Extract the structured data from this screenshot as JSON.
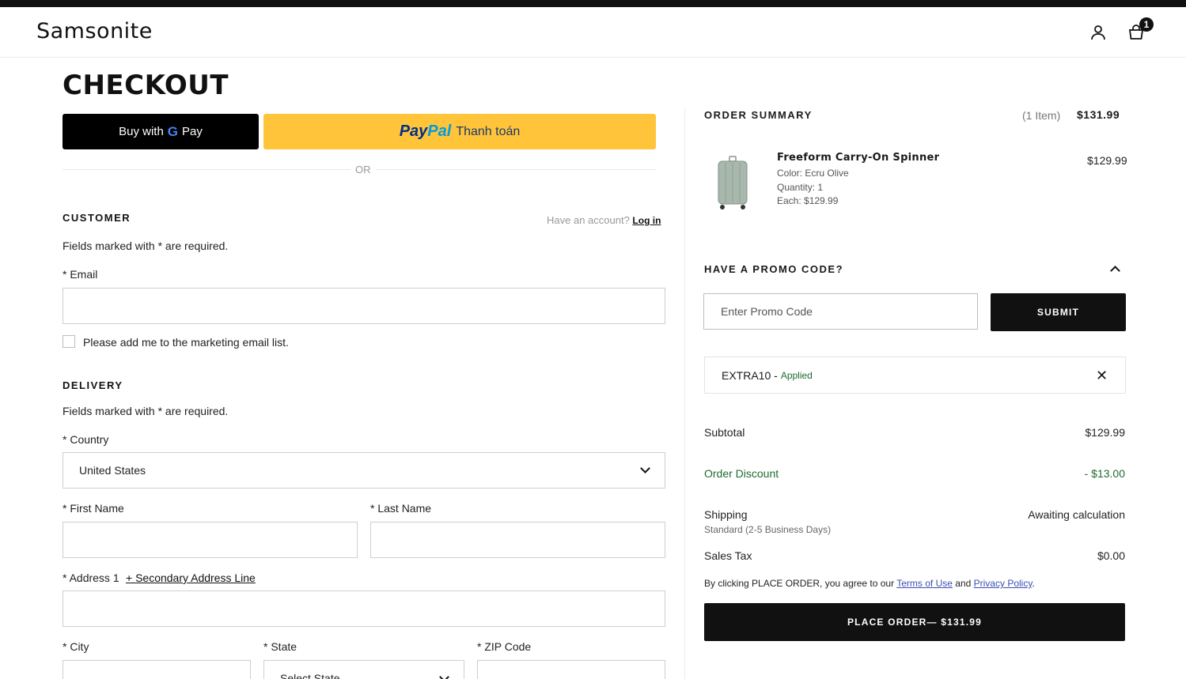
{
  "header": {
    "logo": "Samsonite",
    "cart_count": "1"
  },
  "page_title": "CHECKOUT",
  "express": {
    "gpay_prefix": "Buy with",
    "gpay_g": "G",
    "gpay_pay": "Pay",
    "paypal_pay": "Pay",
    "paypal_pal": "Pal",
    "paypal_text": "Thanh toán",
    "or": "OR"
  },
  "customer": {
    "heading": "CUSTOMER",
    "have_account": "Have an account?",
    "login": "Log in",
    "required_note": "Fields marked with * are required.",
    "email_label": "* Email",
    "email_value": "",
    "marketing_label": "Please add me to the marketing email list."
  },
  "delivery": {
    "heading": "DELIVERY",
    "required_note": "Fields marked with * are required.",
    "country_label": "* Country",
    "country_value": "United States",
    "first_name_label": "* First Name",
    "last_name_label": "* Last Name",
    "address1_label": "* Address 1",
    "secondary_link": "+ Secondary Address Line",
    "city_label": "* City",
    "state_label": "* State",
    "state_value": "Select State",
    "zip_label": "* ZIP Code"
  },
  "summary": {
    "heading": "ORDER SUMMARY",
    "item_count": "(1 Item)",
    "total": "$131.99",
    "product": {
      "name": "Freeform Carry-On Spinner",
      "color": "Color: Ecru Olive",
      "quantity": "Quantity: 1",
      "each": "Each: $129.99",
      "price": "$129.99"
    }
  },
  "promo": {
    "heading": "HAVE A PROMO CODE?",
    "placeholder": "Enter Promo Code",
    "submit": "SUBMIT",
    "applied_code": "EXTRA10 -",
    "applied_status": "Applied"
  },
  "totals": {
    "subtotal_label": "Subtotal",
    "subtotal_value": "$129.99",
    "discount_label": "Order Discount",
    "discount_value": "- $13.00",
    "shipping_label": "Shipping",
    "shipping_method": "Standard (2-5 Business Days)",
    "shipping_value": "Awaiting calculation",
    "tax_label": "Sales Tax",
    "tax_value": "$0.00",
    "agree_prefix": "By clicking PLACE ORDER, you agree to our",
    "terms": "Terms of Use",
    "and": "and",
    "privacy": "Privacy Policy",
    "period": ".",
    "place_order": "PLACE ORDER— $131.99"
  },
  "colors": {
    "primary": "#111111",
    "paypal_yellow": "#FFC439",
    "discount_green": "#1f6b2f",
    "link_blue": "#3a4fb0"
  }
}
